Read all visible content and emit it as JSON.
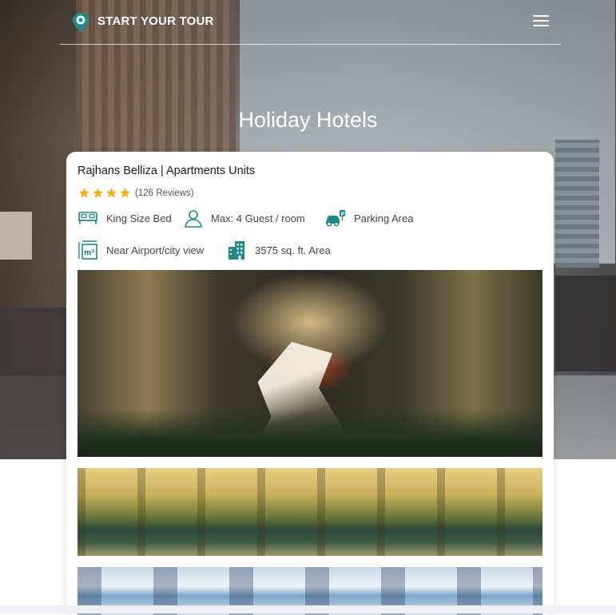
{
  "nav": {
    "brand": "START YOUR TOUR",
    "logo_icon": "map-pin-icon",
    "menu_icon": "hamburger-menu-icon"
  },
  "hero": {
    "title": "Holiday Hotels"
  },
  "card": {
    "title": "Rajhans Belliza | Apartments Units",
    "rating": {
      "stars": 4,
      "reviews": "(126 Reviews)"
    },
    "features": [
      {
        "icon": "bed-icon",
        "label": "King Size Bed"
      },
      {
        "icon": "user-icon",
        "label": "Max: 4 Guest / room"
      },
      {
        "icon": "parking-car-icon",
        "label": "Parking Area"
      },
      {
        "icon": "area-m2-icon",
        "label": "Near Airport/city view"
      },
      {
        "icon": "building-icon",
        "label": "3575 sq. ft. Area"
      }
    ]
  },
  "colors": {
    "accent": "#1f8a8a",
    "star": "#f2b01e",
    "text": "#444444"
  }
}
